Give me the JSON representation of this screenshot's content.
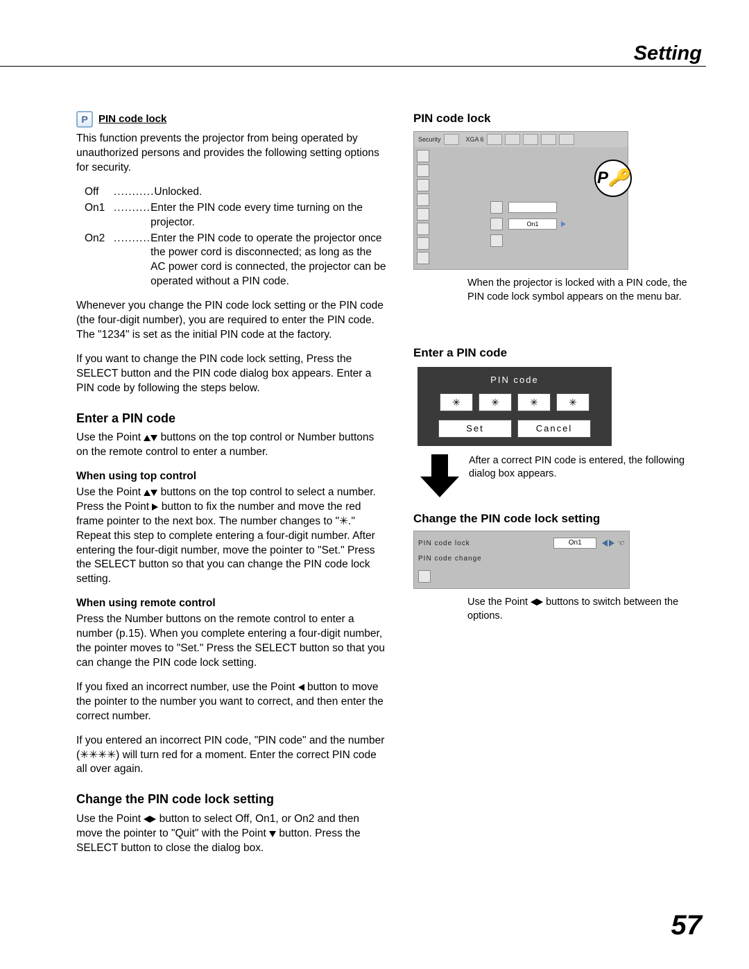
{
  "section_title": "Setting",
  "page_number": "57",
  "left": {
    "pin_header": "PIN code lock",
    "intro": "This function prevents the projector from being operated by unauthorized persons and provides the following setting options for security.",
    "options": [
      {
        "key": "Off",
        "dots": "...........",
        "val": "Unlocked."
      },
      {
        "key": "On1",
        "dots": "..........",
        "val": "Enter the PIN code every time turning on the projector."
      },
      {
        "key": "On2",
        "dots": "..........",
        "val": "Enter the PIN code to operate the projector once the power cord is disconnected; as long as the AC power cord is connected, the projector can be operated without a PIN code."
      }
    ],
    "p2": "Whenever you change the PIN code lock setting or the PIN code (the four-digit number), you are required to enter the PIN code. The \"1234\" is set as the initial PIN code at the factory.",
    "p3": "If you want to change the PIN code lock setting, Press the SELECT button and the PIN code dialog box appears. Enter a PIN code by following the steps below.",
    "h_enter": "Enter a PIN code",
    "enter_pA": "Use the Point ",
    "enter_pB": " buttons on the top control or Number buttons on the remote control to enter a number.",
    "h_top": "When using top control",
    "top_p1a": "Use the Point ",
    "top_p1b": " buttons on the top control to select a number. Press the Point ",
    "top_p1c": " button to fix the number and move the red frame pointer to the next box. The number changes to \"✳.\" Repeat this step to complete entering a four-digit number. After entering the four-digit number, move the pointer to \"Set.\" Press the SELECT button so that you can change the PIN code lock setting.",
    "h_remote": "When using remote control",
    "remote_p": "Press the Number buttons on the remote control to enter a number (p.15). When you complete entering a four-digit number, the pointer moves to \"Set.\" Press the SELECT button so that you can change the PIN code lock setting.",
    "fix_pA": "If you fixed an incorrect number, use the Point ",
    "fix_pB": " button to move the pointer to the number you want to correct, and then enter the correct number.",
    "wrong_p": "If you entered an incorrect PIN code, \"PIN code\" and the number (✳✳✳✳) will turn red for a moment. Enter the correct PIN code all over again.",
    "h_change": "Change the PIN code lock setting",
    "change_pA": "Use the Point ",
    "change_pB": " button to select Off, On1, or On2 and then move the pointer to \"Quit\" with the Point ",
    "change_pC": " button. Press the SELECT button to close the dialog box."
  },
  "right": {
    "h_pin": "PIN code lock",
    "osd1": {
      "security": "Security",
      "mode": "XGA 6",
      "sel_un": "",
      "sel_on1": "On1"
    },
    "badge": "P",
    "note1": "When the projector is locked with a PIN code, the PIN code lock symbol appears on the menu bar.",
    "h_enter": "Enter a PIN code",
    "dialog": {
      "title": "PIN code",
      "star": "✳",
      "set": "Set",
      "cancel": "Cancel"
    },
    "arrow_note": "After a correct PIN code is entered, the following dialog box appears.",
    "h_change": "Change the PIN code lock setting",
    "osd2": {
      "row1": "PIN code lock",
      "row1val": "On1",
      "row2": "PIN code change"
    },
    "note2a": "Use the Point ",
    "note2b": " buttons to switch between the options."
  }
}
